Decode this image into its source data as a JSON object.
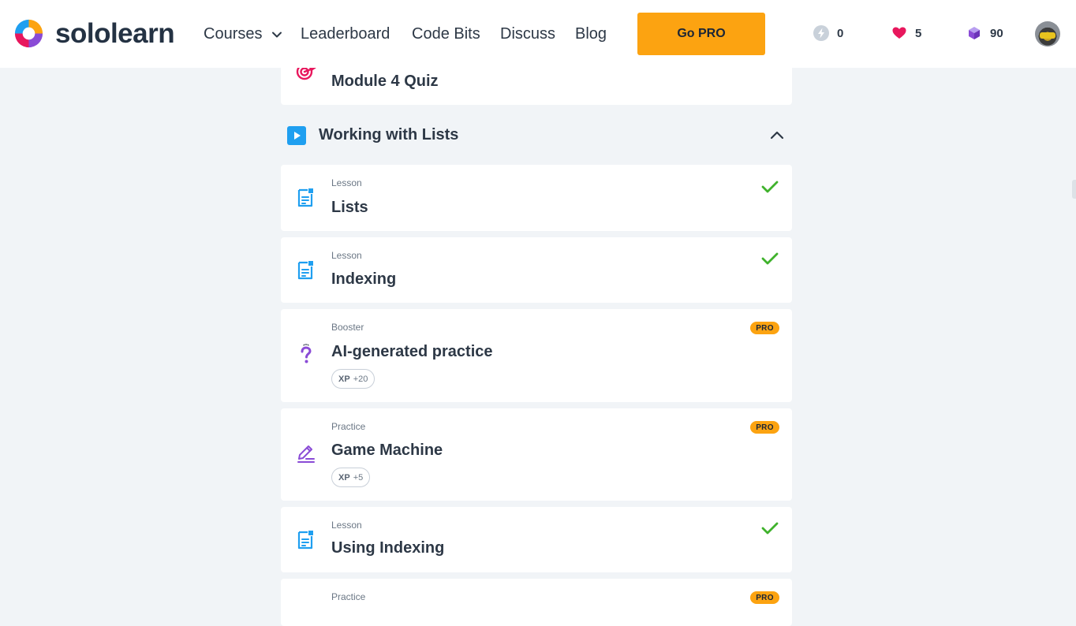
{
  "brand": {
    "name": "sololearn"
  },
  "nav": {
    "courses": "Courses",
    "leaderboard": "Leaderboard",
    "code_bits": "Code Bits",
    "discuss": "Discuss",
    "blog": "Blog",
    "go_pro": "Go PRO"
  },
  "stats": {
    "streak": "0",
    "hearts": "5",
    "bits": "90"
  },
  "prev_item": {
    "title": "Module 4 Quiz",
    "icon": "target-icon"
  },
  "section": {
    "title": "Working with Lists",
    "icon": "play-icon",
    "state": "expanded"
  },
  "items": [
    {
      "type": "Lesson",
      "title": "Lists",
      "icon": "lesson-icon",
      "status": "completed"
    },
    {
      "type": "Lesson",
      "title": "Indexing",
      "icon": "lesson-icon",
      "status": "completed"
    },
    {
      "type": "Booster",
      "title": "AI-generated practice",
      "icon": "question-icon",
      "badge": "PRO",
      "xp_label": "XP",
      "xp_value": "+20"
    },
    {
      "type": "Practice",
      "title": "Game Machine",
      "icon": "pencil-icon",
      "badge": "PRO",
      "xp_label": "XP",
      "xp_value": "+5"
    },
    {
      "type": "Lesson",
      "title": "Using Indexing",
      "icon": "lesson-icon",
      "status": "completed"
    },
    {
      "type": "Practice",
      "badge": "PRO",
      "icon": "pencil-icon"
    }
  ],
  "colors": {
    "accent_orange": "#fca311",
    "lesson_blue": "#1f9ff0",
    "check_green": "#3fb22c",
    "heart_pink": "#e8175d",
    "quiz_pink": "#e8175d",
    "practice_purple": "#8a4bd6",
    "background": "#f1f4f7"
  }
}
